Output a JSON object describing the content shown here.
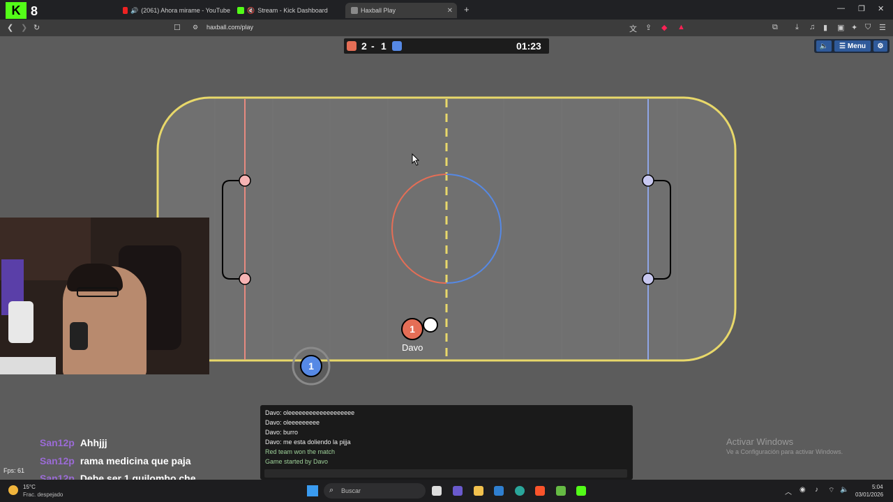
{
  "browser": {
    "tabs": [
      {
        "label": "(2061) Ahora mirame - YouTube",
        "icon": "youtube-icon"
      },
      {
        "label": "Stream - Kick Dashboard",
        "icon": "kick-icon"
      },
      {
        "label": "Haxball Play",
        "icon": "haxball-icon",
        "active": true
      }
    ],
    "url": "haxball.com/play"
  },
  "game": {
    "score_red": "2",
    "score_sep": "-",
    "score_blue": "1",
    "timer": "01:23",
    "menu_label": "Menu",
    "players": [
      {
        "name": "Davo",
        "number": "1",
        "team": "red"
      },
      {
        "name": "",
        "number": "1",
        "team": "blue"
      }
    ],
    "colors": {
      "red_team": "#e56e56",
      "blue_team": "#5689e5",
      "field_border": "#e8d86a",
      "field": "#707070"
    }
  },
  "game_chat": {
    "lines": [
      {
        "text": "Davo: oleeeeeeeeeeeeeeeeeee",
        "type": "user"
      },
      {
        "text": "Davo: oleeeeeeeee",
        "type": "user"
      },
      {
        "text": "Davo: burro",
        "type": "user"
      },
      {
        "text": "Davo: me esta doliendo la pijja",
        "type": "user"
      },
      {
        "text": "Red team won the match",
        "type": "system"
      },
      {
        "text": "Game started by Davo",
        "type": "system"
      }
    ]
  },
  "stream_chat": [
    {
      "user": "San12p",
      "message": "Ahhjjj"
    },
    {
      "user": "San12p",
      "message": "rama medicina que paja"
    },
    {
      "user": "San12p",
      "message": "Debe ser 1 quilombo che"
    }
  ],
  "overlay": {
    "fps": "Fps: 61",
    "activate_title": "Activar Windows",
    "activate_sub": "Ve a Configuración para activar Windows."
  },
  "taskbar": {
    "weather_temp": "15°C",
    "weather_desc": "Frac. despejado",
    "search_placeholder": "Buscar",
    "time": "5:04",
    "date": "03/01/2026"
  }
}
